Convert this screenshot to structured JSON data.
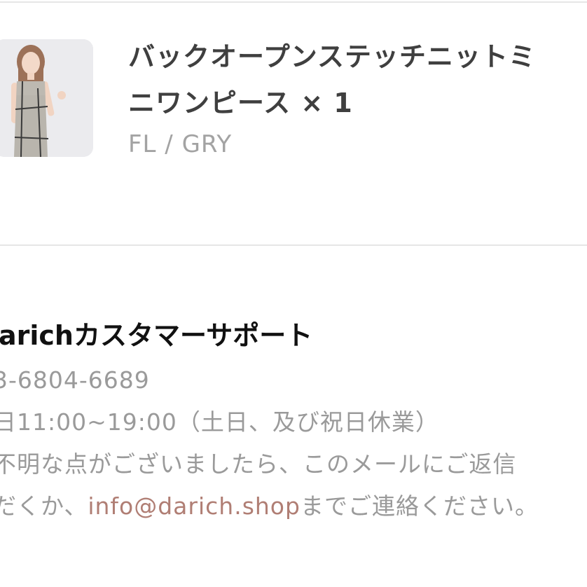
{
  "order_item": {
    "product_name_line1": "バックオープンステッチニットミ",
    "product_name_line2": "ニワンピース × 1",
    "variant": "FL / GRY",
    "thumbnail": "product-photo-dress"
  },
  "support": {
    "title": "arichカスタマーサポート",
    "phone": "3-6804-6689",
    "hours": "日11:00~19:00（土日、及び祝日休業）",
    "message_line1": "不明な点がございましたら、このメールにご返信",
    "message_line2_before": "だくか、",
    "email": "info@darich.shop",
    "message_line2_after": "までご連絡ください。"
  },
  "colors": {
    "divider": "#e6e6e6",
    "link": "#b07e74",
    "muted_text": "#9a9a9a",
    "title_text": "#111111"
  }
}
